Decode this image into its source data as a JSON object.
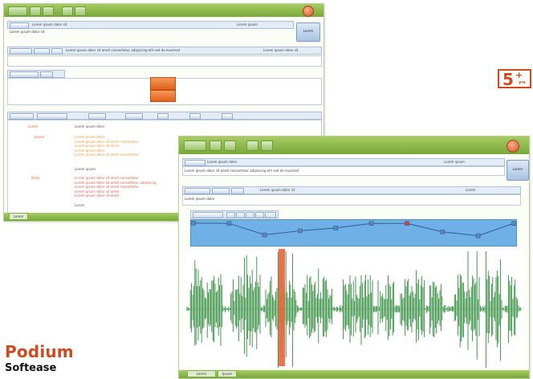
{
  "brand": {
    "title": "Podium",
    "subtitle": "Softease"
  },
  "age_badge": {
    "number": "5",
    "plus": "+",
    "unit": "yrs"
  },
  "back_window": {
    "title_field": "Lorem ipsum dolor sit",
    "title_right": "Lorem ipsum",
    "title_line2": "Lorem ipsum dolor sit",
    "big_button": "Lorem",
    "script_row_text": "Lorem ipsum dolor sit amet consectetur adipiscing elit sed do eiusmod",
    "script_row_right": "Lorem ipsum dolor sit",
    "notes_heading": "Lorem ipsum dolor",
    "labels": [
      "Lorem",
      "Ipsum",
      "Dolor"
    ],
    "orange_lines": [
      "Lorem ipsum dolor",
      "Lorem ipsum dolor sit amet consectetur",
      "Lorem ipsum dolor sit amet",
      "Lorem ipsum dolor",
      "Lorem ipsum dolor sit amet consectetur"
    ],
    "dark_line_1": "Lorem ipsum",
    "red_lines": [
      "Lorem ipsum dolor sit amet consectetur",
      "Lorem ipsum dolor sit amet consectetur adipiscing",
      "Lorem ipsum dolor sit amet consectetur",
      "Lorem ipsum dolor sit amet",
      "Lorem ipsum dolor sit amet"
    ],
    "dark_line_2": "Lorem",
    "bottom_tab": "Lorem"
  },
  "front_window": {
    "title_field": "Lorem ipsum dolor",
    "title_right": "Lorem ipsum",
    "desc_line": "Lorem ipsum dolor sit amet consectetur adipiscing elit sed do eiusmod",
    "big_button": "Lorem",
    "script_row_text": "Lorem ipsum dolor sit",
    "script_row_right": "Lorem",
    "script_line2": "Lorem ipsum dolor",
    "bottom_tabs": [
      "Lorem",
      "Ipsum"
    ]
  },
  "colors": {
    "green_bar": "#8fbf4a",
    "envelope": "#6fb0e6",
    "waveform": "#2e8b3a",
    "playhead": "#e8673e",
    "brand_red": "#cf4a1e"
  },
  "envelope_points": [
    0.08,
    0.1,
    0.75,
    0.52,
    0.36,
    0.1,
    0.1,
    0.58,
    0.8,
    0.1
  ],
  "icons": {
    "close": "close-icon",
    "playhead": "playhead-icon"
  }
}
